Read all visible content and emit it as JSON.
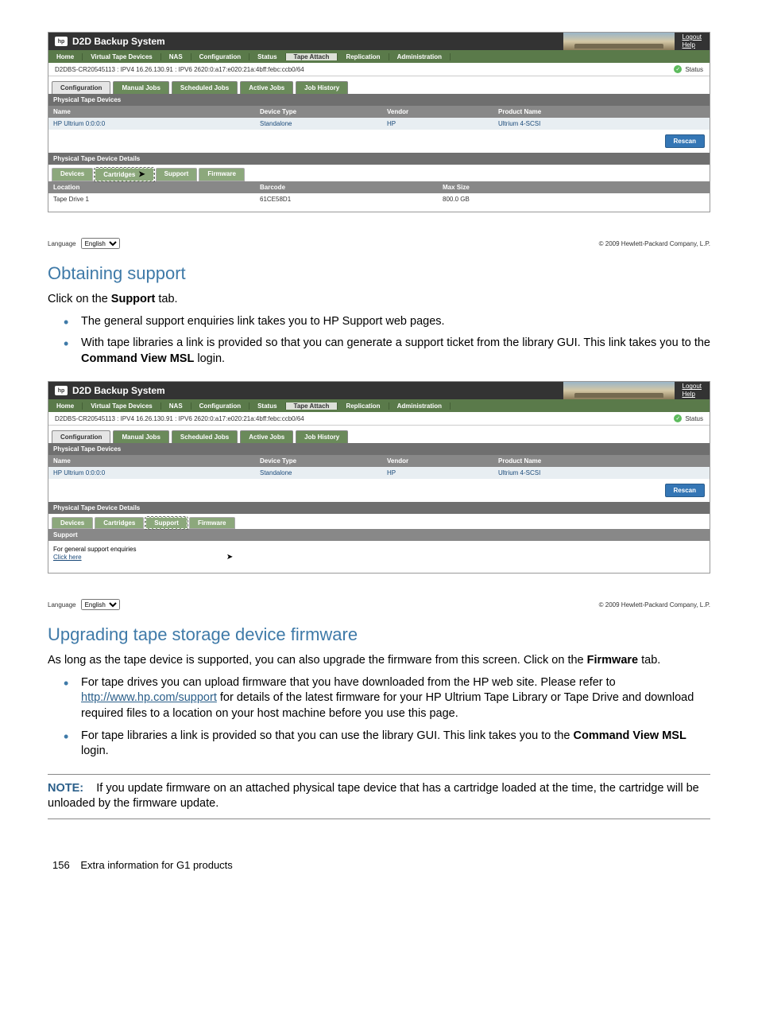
{
  "app": {
    "logo_text": "hp",
    "title": "D2D Backup System",
    "logout": "Logout",
    "help": "Help"
  },
  "topnav": [
    "Home",
    "Virtual Tape Devices",
    "NAS",
    "Configuration",
    "Status",
    "Tape Attach",
    "Replication",
    "Administration"
  ],
  "topnav_active": 5,
  "status_line": "D2DBS-CR20545113 : IPV4 16.26.130.91 : IPV6 2620:0:a17:e020:21a:4bff:febc:ccb0/64",
  "status_label": "Status",
  "subtabs": [
    "Configuration",
    "Manual Jobs",
    "Scheduled Jobs",
    "Active Jobs",
    "Job History"
  ],
  "subtabs_active": 0,
  "panel1_title": "Physical Tape Devices",
  "table1": {
    "headers": [
      "Name",
      "Device Type",
      "Vendor",
      "Product Name"
    ],
    "row": [
      "HP Ultrium 0:0:0:0",
      "Standalone",
      "HP",
      "Ultrium 4-SCSI"
    ]
  },
  "rescan_btn": "Rescan",
  "panel2_title": "Physical Tape Device Details",
  "detail_tabs": [
    "Devices",
    "Cartridges",
    "Support",
    "Firmware"
  ],
  "shot1": {
    "active_detail": 1,
    "dtable": {
      "headers": [
        "Location",
        "Barcode",
        "Max Size"
      ],
      "row": [
        "Tape Drive 1",
        "61CE58D1",
        "800.0 GB"
      ]
    }
  },
  "shot2": {
    "active_detail": 2,
    "support_head": "Support",
    "support_text": "For general support enquiries",
    "support_link": "Click here"
  },
  "language_label": "Language",
  "language_value": "English",
  "copyright": "© 2009 Hewlett-Packard Company, L.P.",
  "doc": {
    "h1": "Obtaining support",
    "p1_a": "Click on the ",
    "p1_b": "Support",
    "p1_c": " tab.",
    "li1": "The general support enquiries link takes you to HP Support web pages.",
    "li2_a": "With tape libraries a link is provided so that you can generate a support ticket from the library GUI. This link takes you to the ",
    "li2_b": "Command View MSL",
    "li2_c": " login.",
    "h2": "Upgrading tape storage device firmware",
    "p2_a": "As long as the tape device is supported, you can also upgrade the firmware from this screen. Click on the ",
    "p2_b": "Firmware",
    "p2_c": " tab.",
    "li3_a": "For tape drives you can upload firmware that you have downloaded from the HP web site. Please refer to ",
    "li3_link": "http://www.hp.com/support",
    "li3_b": " for details of the latest firmware for your HP Ultrium Tape Library or Tape Drive and download required files to a location on your host machine before you use this page.",
    "li4_a": "For tape libraries a link is provided so that you can use the library GUI. This link takes you to the ",
    "li4_b": "Command View MSL",
    "li4_c": " login.",
    "note_label": "NOTE:",
    "note_text": "If you update firmware on an attached physical tape device that has a cartridge loaded at the time, the cartridge will be unloaded by the firmware update.",
    "page_num": "156",
    "page_section": "Extra information for G1 products"
  }
}
